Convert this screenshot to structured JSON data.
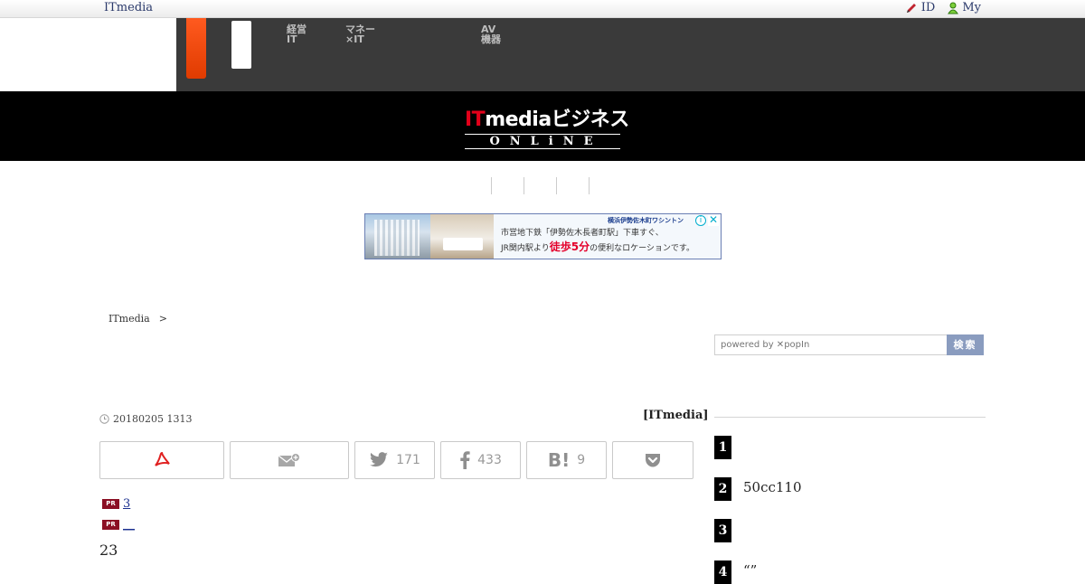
{
  "topbar": {
    "brand": "ITmedia",
    "id_label": "ID",
    "my_label": "My"
  },
  "nav": {
    "items": [
      {
        "line1": "経営",
        "line2": "IT"
      },
      {
        "line1": "マネー",
        "line2": "×IT"
      },
      {
        "line1": "AV",
        "line2": "機器"
      }
    ]
  },
  "logo": {
    "it": "IT",
    "media": "media",
    "jp": "ビジネス",
    "online": "ONLiNE"
  },
  "ad": {
    "brand": "横浜伊勢佐木町ワシントン",
    "line1": "市営地下鉄「伊勢佐木長者町駅」下車すぐ、",
    "line2_pre": "JR関内駅より",
    "line2_hi": "徒歩5分",
    "line2_post": "の便利なロケーションです。",
    "info": "i",
    "close": "✕"
  },
  "breadcrumb": {
    "home": "ITmedia",
    "sep": ">"
  },
  "search": {
    "placeholder": "powered by ✕popIn",
    "button": "検索"
  },
  "article": {
    "date": "20180205 1313",
    "author": "[ITmedia]",
    "body": "23"
  },
  "share": {
    "twitter_count": "171",
    "facebook_count": "433",
    "hatena_count": "9"
  },
  "pr": [
    {
      "badge": "PR",
      "text": "3"
    },
    {
      "badge": "PR",
      "text": "__"
    }
  ],
  "ranking": [
    {
      "num": "1",
      "title": ""
    },
    {
      "num": "2",
      "title": "50cc110"
    },
    {
      "num": "3",
      "title": ""
    },
    {
      "num": "4",
      "title": "“”"
    }
  ],
  "colors": {
    "accent_orange": "#ff5a1f",
    "nav_dark": "#3a3a3a",
    "pr_badge": "#8b0f24",
    "search_button": "#8a9cbf"
  }
}
